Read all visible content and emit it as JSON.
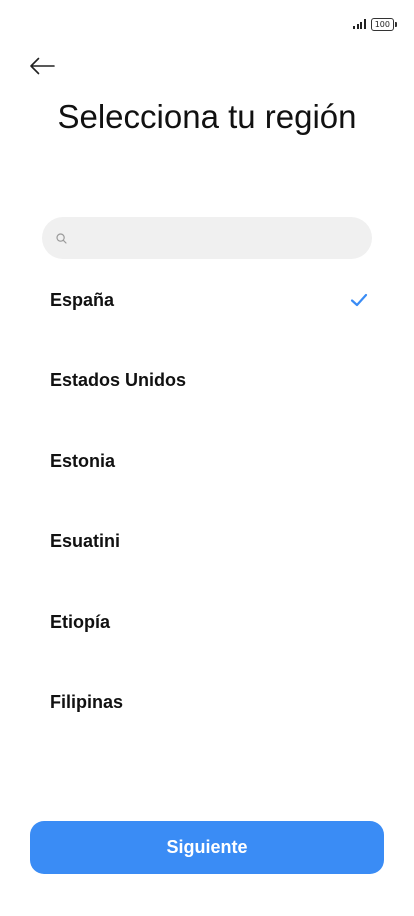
{
  "status_bar": {
    "battery_level": "100",
    "signal_icon": "signal-bars-icon"
  },
  "header": {
    "back_icon": "arrow-left-icon",
    "title": "Selecciona tu región"
  },
  "search": {
    "value": "",
    "placeholder": "",
    "icon": "search-icon"
  },
  "regions": {
    "items": [
      {
        "label": "España",
        "selected": true
      },
      {
        "label": "Estados Unidos",
        "selected": false
      },
      {
        "label": "Estonia",
        "selected": false
      },
      {
        "label": "Esuatini",
        "selected": false
      },
      {
        "label": "Etiopía",
        "selected": false
      },
      {
        "label": "Filipinas",
        "selected": false
      }
    ],
    "selected_icon": "checkmark-icon"
  },
  "footer": {
    "next_label": "Siguiente"
  },
  "colors": {
    "accent": "#3a8cf5",
    "search_background": "#f0f0f0",
    "text": "#111111",
    "background": "#ffffff"
  }
}
